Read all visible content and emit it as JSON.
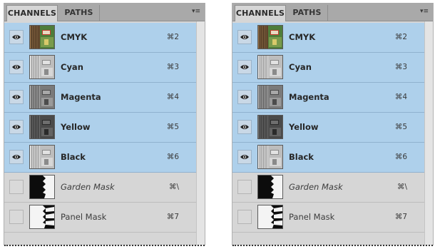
{
  "panels": [
    {
      "tabs": {
        "active": "CHANNELS",
        "inactive": "PATHS"
      },
      "menu_icon": "panel-menu-icon",
      "channels": [
        {
          "name": "CMYK",
          "shortcut": "⌘2",
          "visible": true,
          "selected": true,
          "thumb": "composite"
        },
        {
          "name": "Cyan",
          "shortcut": "⌘3",
          "visible": true,
          "selected": true,
          "thumb": "light"
        },
        {
          "name": "Magenta",
          "shortcut": "⌘4",
          "visible": true,
          "selected": true,
          "thumb": "mid"
        },
        {
          "name": "Yellow",
          "shortcut": "⌘5",
          "visible": true,
          "selected": true,
          "thumb": "dark"
        },
        {
          "name": "Black",
          "shortcut": "⌘6",
          "visible": true,
          "selected": true,
          "thumb": "light"
        },
        {
          "name": "Garden Mask",
          "shortcut": "⌘\\",
          "visible": false,
          "selected": false,
          "thumb": "mask-dark"
        },
        {
          "name": "Panel Mask",
          "shortcut": "⌘7",
          "visible": false,
          "selected": false,
          "thumb": "mask-light"
        }
      ]
    },
    {
      "tabs": {
        "active": "CHANNELS",
        "inactive": "PATHS"
      },
      "menu_icon": "panel-menu-icon",
      "channels": [
        {
          "name": "CMYK",
          "shortcut": "⌘2",
          "visible": true,
          "selected": true,
          "thumb": "composite"
        },
        {
          "name": "Cyan",
          "shortcut": "⌘3",
          "visible": true,
          "selected": true,
          "thumb": "light"
        },
        {
          "name": "Magenta",
          "shortcut": "⌘4",
          "visible": true,
          "selected": true,
          "thumb": "mid"
        },
        {
          "name": "Yellow",
          "shortcut": "⌘5",
          "visible": true,
          "selected": true,
          "thumb": "dark"
        },
        {
          "name": "Black",
          "shortcut": "⌘6",
          "visible": true,
          "selected": true,
          "thumb": "light"
        },
        {
          "name": "Garden Mask",
          "shortcut": "⌘\\",
          "visible": false,
          "selected": false,
          "thumb": "mask-dark"
        },
        {
          "name": "Panel Mask",
          "shortcut": "⌘7",
          "visible": false,
          "selected": false,
          "thumb": "mask-light"
        }
      ]
    }
  ],
  "colors": {
    "selected_row": "#aed0eb",
    "panel_bg": "#d6d6d6",
    "tabbar_bg": "#a9a9a9"
  }
}
